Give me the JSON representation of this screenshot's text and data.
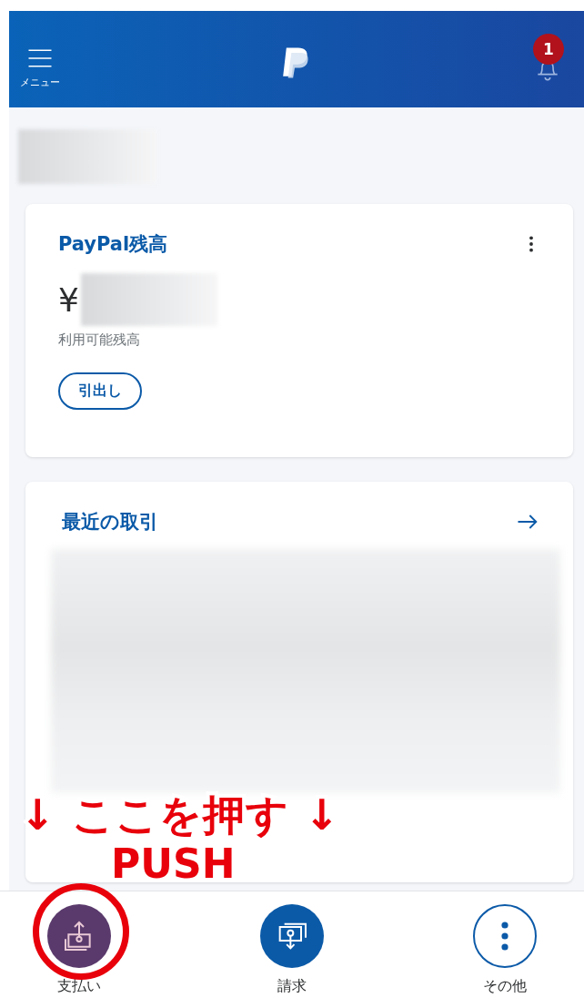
{
  "header": {
    "menu_label": "メニュー",
    "notification_count": "1"
  },
  "account_name": {
    "redacted": true
  },
  "balance_card": {
    "title": "PayPal残高",
    "currency": "¥",
    "amount_redacted": true,
    "caption": "利用可能残高",
    "button": "引出し"
  },
  "activity_card": {
    "title": "最近の取引",
    "content_redacted": true
  },
  "bottom_nav": [
    {
      "label": "支払い",
      "kind": "filled",
      "color": "#5a3a6c"
    },
    {
      "label": "請求",
      "kind": "filled",
      "color": "#0b5aa8"
    },
    {
      "label": "その他",
      "kind": "outlined",
      "color": "#0b5aa8"
    }
  ],
  "annotation": {
    "lines": [
      "↓ ここを押す ↓",
      "PUSH"
    ]
  }
}
